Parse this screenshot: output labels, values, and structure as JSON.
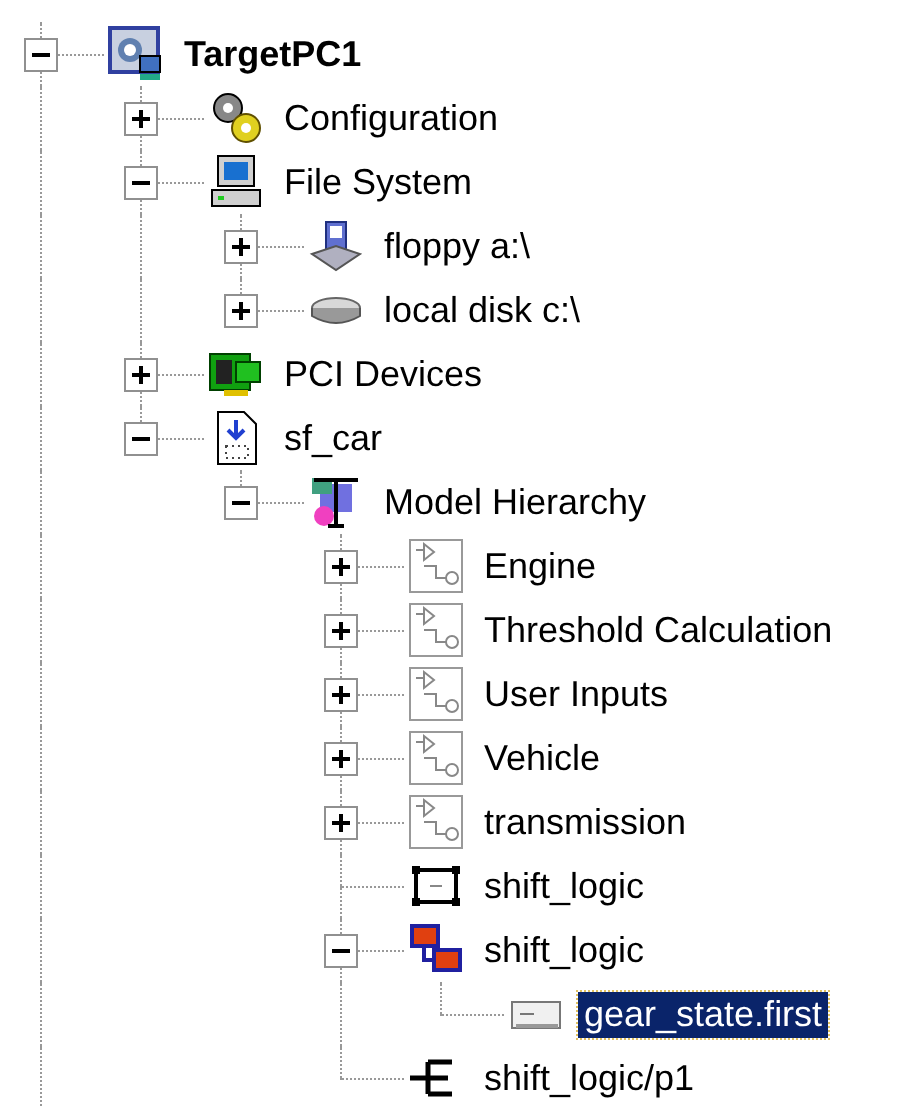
{
  "tree": [
    {
      "label": "TargetPC1",
      "kind": "target",
      "expanded": true,
      "selected": false,
      "children": [
        {
          "label": "Configuration",
          "kind": "config",
          "expanded": false,
          "selected": false
        },
        {
          "label": "File System",
          "kind": "computer",
          "expanded": true,
          "selected": false,
          "children": [
            {
              "label": "floppy a:\\",
              "kind": "floppy",
              "expanded": false,
              "selected": false
            },
            {
              "label": "local disk c:\\",
              "kind": "disk",
              "expanded": false,
              "selected": false
            }
          ]
        },
        {
          "label": "PCI Devices",
          "kind": "board",
          "expanded": false,
          "selected": false
        },
        {
          "label": "sf_car",
          "kind": "file",
          "expanded": true,
          "selected": false,
          "children": [
            {
              "label": "Model Hierarchy",
              "kind": "hierarchy",
              "expanded": true,
              "selected": false,
              "children": [
                {
                  "label": "Engine",
                  "kind": "subsystem",
                  "expanded": false,
                  "selected": false
                },
                {
                  "label": "Threshold Calculation",
                  "kind": "subsystem",
                  "expanded": false,
                  "selected": false
                },
                {
                  "label": "User Inputs",
                  "kind": "subsystem",
                  "expanded": false,
                  "selected": false
                },
                {
                  "label": "Vehicle",
                  "kind": "subsystem",
                  "expanded": false,
                  "selected": false
                },
                {
                  "label": "transmission",
                  "kind": "subsystem",
                  "expanded": false,
                  "selected": false
                },
                {
                  "label": "shift_logic",
                  "kind": "chart",
                  "selected": false
                },
                {
                  "label": "shift_logic",
                  "kind": "stateflow",
                  "expanded": true,
                  "selected": false,
                  "children": [
                    {
                      "label": "gear_state.first",
                      "kind": "signal",
                      "selected": true
                    }
                  ]
                },
                {
                  "label": "shift_logic/p1",
                  "kind": "parameter",
                  "selected": false
                }
              ]
            }
          ]
        }
      ]
    }
  ]
}
